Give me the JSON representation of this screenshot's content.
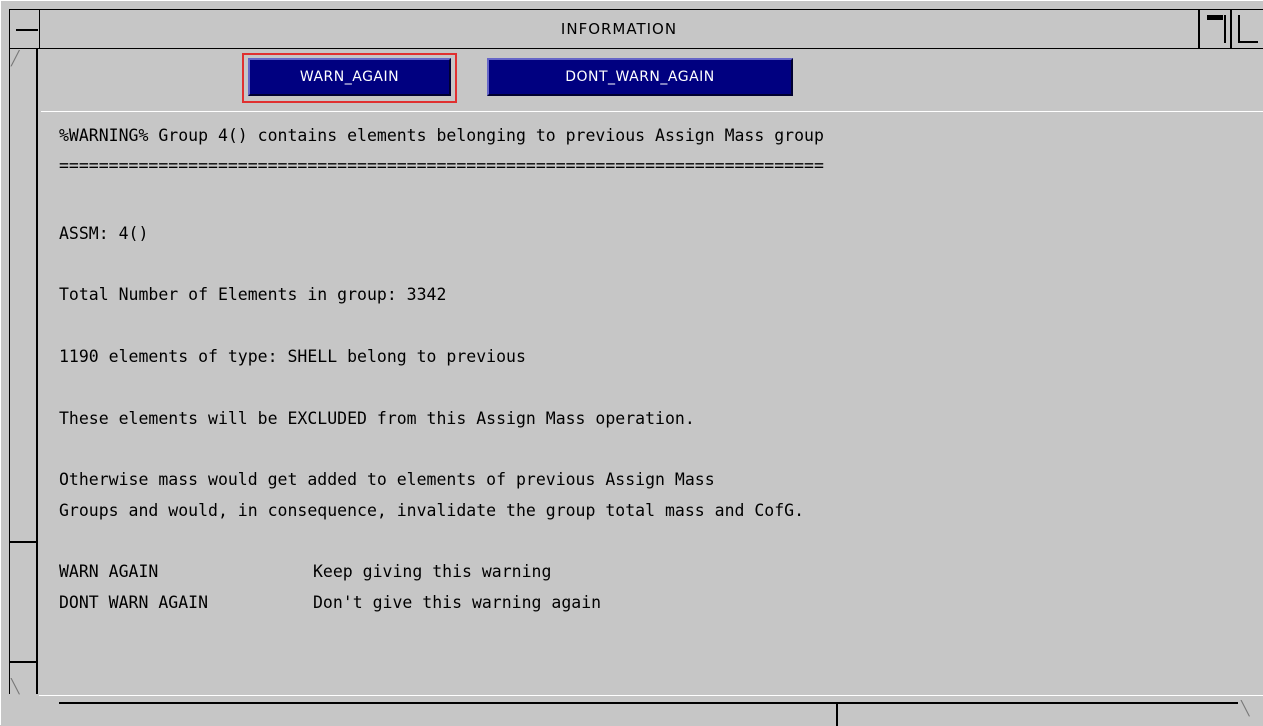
{
  "window": {
    "title": "INFORMATION"
  },
  "buttons": {
    "warn_again": "WARN_AGAIN",
    "dont_warn_again": "DONT_WARN_AGAIN"
  },
  "message": {
    "warning": "%WARNING% Group 4() contains elements belonging to previous Assign Mass group",
    "separator": "=============================================================================",
    "assm": "ASSM: 4()",
    "total": "Total Number of Elements in group: 3342",
    "shell": "1190 elements of type: SHELL belong to previous",
    "excluded": "These elements will be EXCLUDED from this Assign Mass operation.",
    "otherwise_1": "Otherwise mass would get added to elements of previous Assign Mass",
    "otherwise_2": "Groups and would, in consequence, invalidate the group total mass and CofG.",
    "legend": [
      {
        "key": "WARN AGAIN",
        "desc": "Keep giving this warning"
      },
      {
        "key": "DONT WARN AGAIN",
        "desc": "Don't give this warning again"
      }
    ]
  },
  "colors": {
    "background": "#c6c6c6",
    "button": "#000080",
    "button_text": "#ffffff",
    "highlight": "#e03030"
  }
}
